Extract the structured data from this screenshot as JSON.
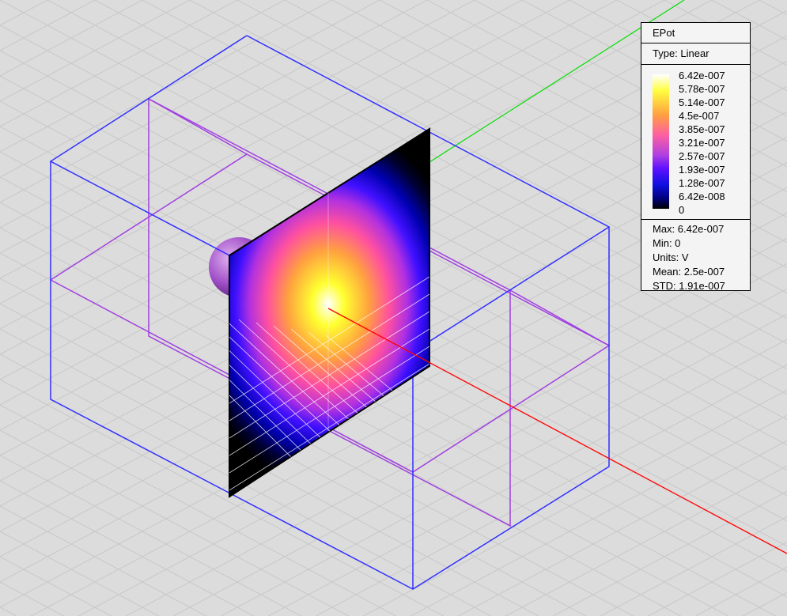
{
  "legend": {
    "title": "EPot",
    "type": "Type: Linear",
    "ticks": [
      "6.42e-007",
      "5.78e-007",
      "5.14e-007",
      "4.5e-007",
      "3.85e-007",
      "3.21e-007",
      "2.57e-007",
      "1.93e-007",
      "1.28e-007",
      "6.42e-008",
      "0"
    ],
    "stats": {
      "max": "Max: 6.42e-007",
      "min": "Min: 0",
      "units": "Units: V",
      "mean": "Mean: 2.5e-007",
      "std": "STD: 1.91e-007"
    }
  },
  "colors": {
    "background": "#dcdcdc",
    "outer_box": "#3030ff",
    "inner_box": "#a040e0",
    "x_axis": "#ff0000",
    "y_axis": "#00dd00",
    "sphere": "#a050c8"
  }
}
